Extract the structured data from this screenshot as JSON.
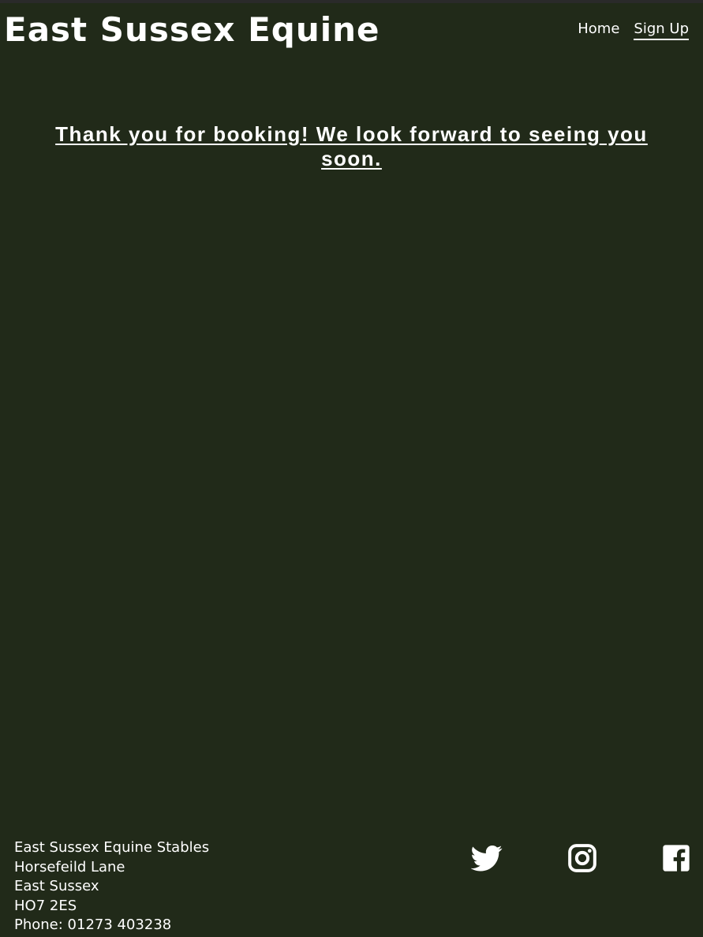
{
  "header": {
    "site_title": "East Sussex Equine",
    "nav": [
      {
        "label": "Home",
        "active": false
      },
      {
        "label": "Sign Up",
        "active": true
      }
    ]
  },
  "main": {
    "message": "Thank you for booking! We look forward to seeing you soon."
  },
  "footer": {
    "address_lines": [
      "East Sussex Equine Stables",
      "Horsefeild Lane",
      "East Sussex",
      "HO7 2ES",
      "Phone: 01273 403238"
    ],
    "social_icons": [
      "twitter-icon",
      "instagram-icon",
      "facebook-icon"
    ]
  },
  "colors": {
    "background": "#212a19",
    "text": "#ffffff"
  }
}
